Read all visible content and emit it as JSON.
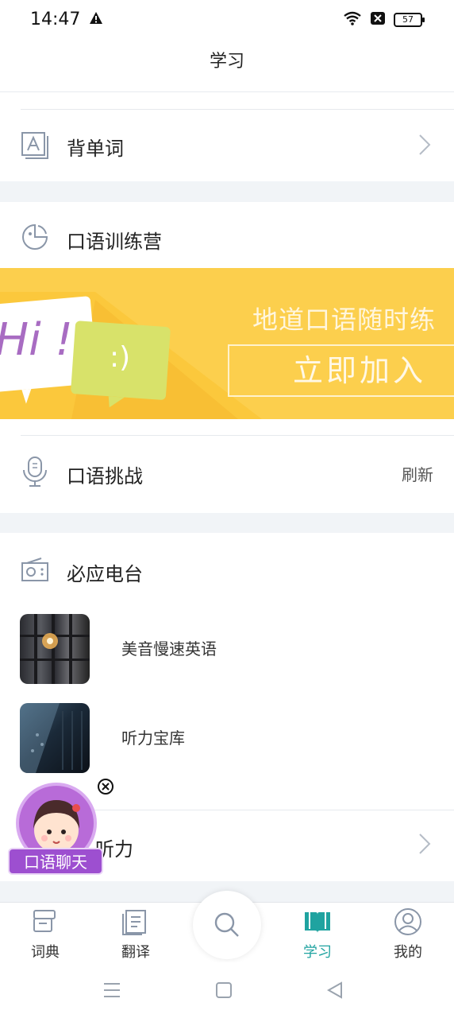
{
  "status_bar": {
    "time": "14:47",
    "battery": "57"
  },
  "header": {
    "title": "学习"
  },
  "rows": {
    "vocab": {
      "label": "背单词"
    },
    "speaking_camp": {
      "label": "口语训练营"
    },
    "speaking_challenge": {
      "label": "口语挑战",
      "action": "刷新"
    },
    "radio": {
      "label": "必应电台"
    },
    "listening": {
      "label": "听力"
    }
  },
  "banner": {
    "hi_text": "Hi !",
    "smiley": ":)",
    "headline": "地道口语随时练",
    "cta": "立即加入"
  },
  "radio_items": [
    {
      "title": "美音慢速英语"
    },
    {
      "title": "听力宝库"
    }
  ],
  "floating": {
    "label": "口语聊天"
  },
  "tabbar": {
    "tabs": [
      {
        "label": "词典"
      },
      {
        "label": "翻译"
      },
      {
        "label": "学习"
      },
      {
        "label": "我的"
      }
    ],
    "active_color": "#1fa3a0"
  }
}
